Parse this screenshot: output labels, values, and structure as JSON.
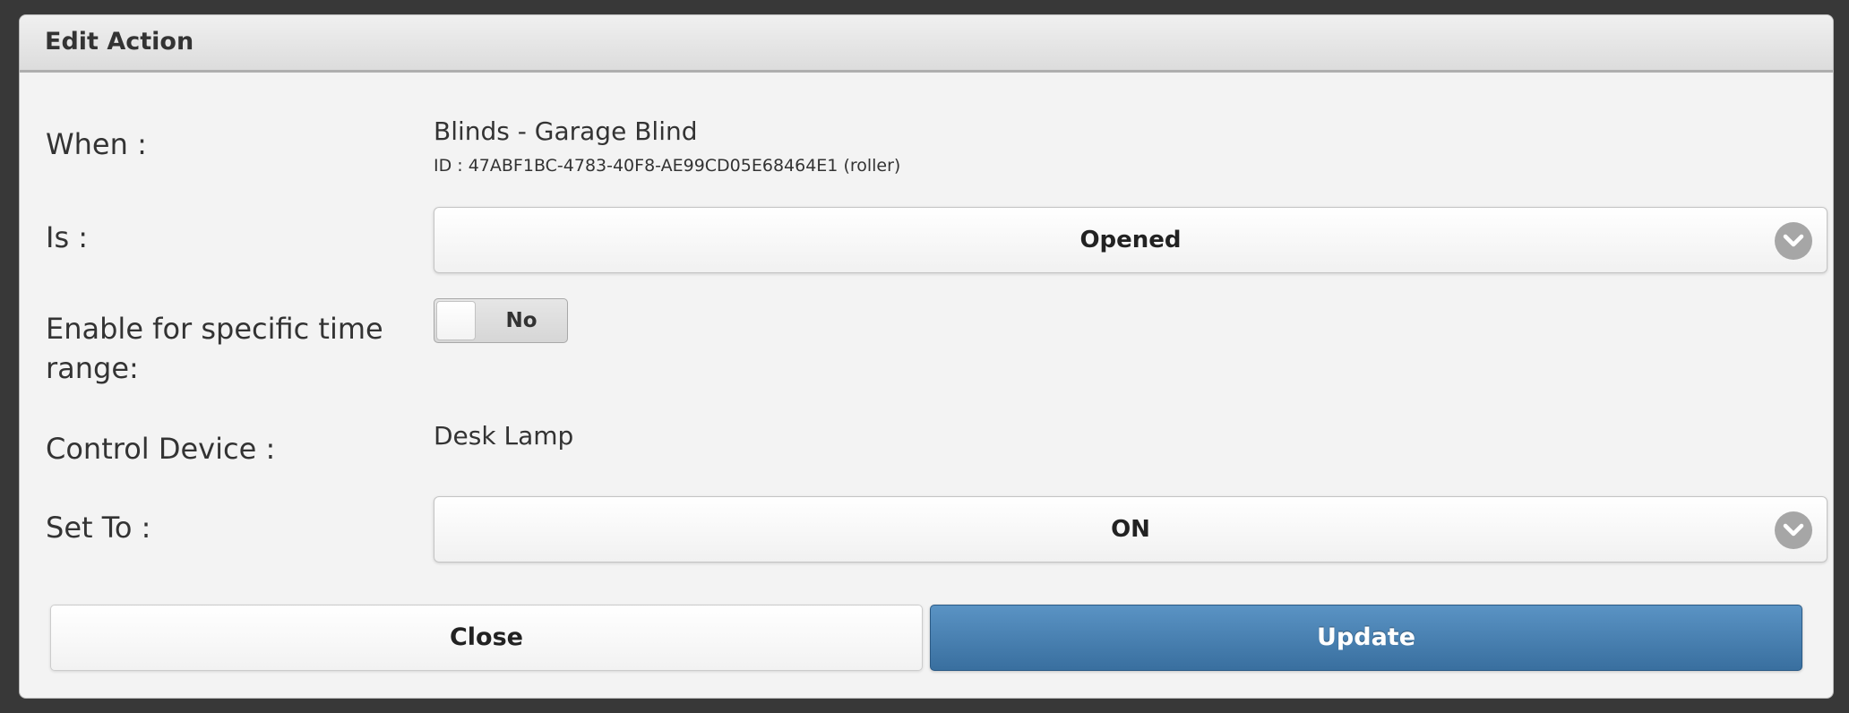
{
  "dialog": {
    "title": "Edit Action"
  },
  "when": {
    "label": "When :",
    "device_name": "Blinds - Garage Blind",
    "device_id": "ID : 47ABF1BC-4783-40F8-AE99CD05E68464E1 (roller)"
  },
  "is": {
    "label": "Is :",
    "selected": "Opened"
  },
  "time_range": {
    "label_line1": "Enable for specific time",
    "label_line2": "range:",
    "toggle_value": "No"
  },
  "control_device": {
    "label": "Control Device :",
    "value": "Desk Lamp"
  },
  "set_to": {
    "label": "Set To :",
    "selected": "ON"
  },
  "buttons": {
    "close": "Close",
    "update": "Update"
  },
  "icons": {
    "select_arrow": "chevron-down-icon"
  },
  "colors": {
    "accent": "#4a82b3",
    "header_bg": "#e2e2e2",
    "dialog_bg": "#f3f3f3"
  }
}
